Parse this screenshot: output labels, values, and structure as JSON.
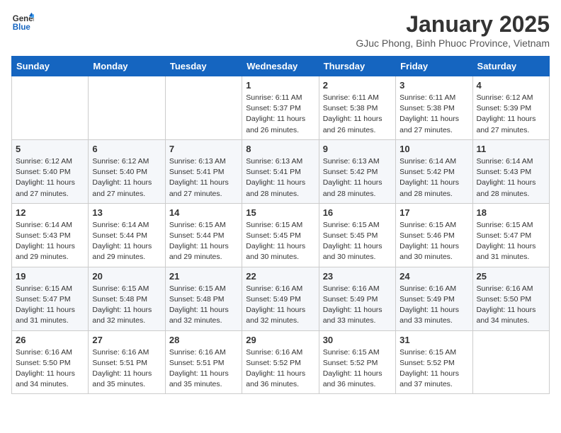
{
  "header": {
    "logo_line1": "General",
    "logo_line2": "Blue",
    "month_title": "January 2025",
    "subtitle": "GJuc Phong, Binh Phuoc Province, Vietnam"
  },
  "days_of_week": [
    "Sunday",
    "Monday",
    "Tuesday",
    "Wednesday",
    "Thursday",
    "Friday",
    "Saturday"
  ],
  "weeks": [
    [
      {
        "day": "",
        "info": ""
      },
      {
        "day": "",
        "info": ""
      },
      {
        "day": "",
        "info": ""
      },
      {
        "day": "1",
        "info": "Sunrise: 6:11 AM\nSunset: 5:37 PM\nDaylight: 11 hours and 26 minutes."
      },
      {
        "day": "2",
        "info": "Sunrise: 6:11 AM\nSunset: 5:38 PM\nDaylight: 11 hours and 26 minutes."
      },
      {
        "day": "3",
        "info": "Sunrise: 6:11 AM\nSunset: 5:38 PM\nDaylight: 11 hours and 27 minutes."
      },
      {
        "day": "4",
        "info": "Sunrise: 6:12 AM\nSunset: 5:39 PM\nDaylight: 11 hours and 27 minutes."
      }
    ],
    [
      {
        "day": "5",
        "info": "Sunrise: 6:12 AM\nSunset: 5:40 PM\nDaylight: 11 hours and 27 minutes."
      },
      {
        "day": "6",
        "info": "Sunrise: 6:12 AM\nSunset: 5:40 PM\nDaylight: 11 hours and 27 minutes."
      },
      {
        "day": "7",
        "info": "Sunrise: 6:13 AM\nSunset: 5:41 PM\nDaylight: 11 hours and 27 minutes."
      },
      {
        "day": "8",
        "info": "Sunrise: 6:13 AM\nSunset: 5:41 PM\nDaylight: 11 hours and 28 minutes."
      },
      {
        "day": "9",
        "info": "Sunrise: 6:13 AM\nSunset: 5:42 PM\nDaylight: 11 hours and 28 minutes."
      },
      {
        "day": "10",
        "info": "Sunrise: 6:14 AM\nSunset: 5:42 PM\nDaylight: 11 hours and 28 minutes."
      },
      {
        "day": "11",
        "info": "Sunrise: 6:14 AM\nSunset: 5:43 PM\nDaylight: 11 hours and 28 minutes."
      }
    ],
    [
      {
        "day": "12",
        "info": "Sunrise: 6:14 AM\nSunset: 5:43 PM\nDaylight: 11 hours and 29 minutes."
      },
      {
        "day": "13",
        "info": "Sunrise: 6:14 AM\nSunset: 5:44 PM\nDaylight: 11 hours and 29 minutes."
      },
      {
        "day": "14",
        "info": "Sunrise: 6:15 AM\nSunset: 5:44 PM\nDaylight: 11 hours and 29 minutes."
      },
      {
        "day": "15",
        "info": "Sunrise: 6:15 AM\nSunset: 5:45 PM\nDaylight: 11 hours and 30 minutes."
      },
      {
        "day": "16",
        "info": "Sunrise: 6:15 AM\nSunset: 5:45 PM\nDaylight: 11 hours and 30 minutes."
      },
      {
        "day": "17",
        "info": "Sunrise: 6:15 AM\nSunset: 5:46 PM\nDaylight: 11 hours and 30 minutes."
      },
      {
        "day": "18",
        "info": "Sunrise: 6:15 AM\nSunset: 5:47 PM\nDaylight: 11 hours and 31 minutes."
      }
    ],
    [
      {
        "day": "19",
        "info": "Sunrise: 6:15 AM\nSunset: 5:47 PM\nDaylight: 11 hours and 31 minutes."
      },
      {
        "day": "20",
        "info": "Sunrise: 6:15 AM\nSunset: 5:48 PM\nDaylight: 11 hours and 32 minutes."
      },
      {
        "day": "21",
        "info": "Sunrise: 6:15 AM\nSunset: 5:48 PM\nDaylight: 11 hours and 32 minutes."
      },
      {
        "day": "22",
        "info": "Sunrise: 6:16 AM\nSunset: 5:49 PM\nDaylight: 11 hours and 32 minutes."
      },
      {
        "day": "23",
        "info": "Sunrise: 6:16 AM\nSunset: 5:49 PM\nDaylight: 11 hours and 33 minutes."
      },
      {
        "day": "24",
        "info": "Sunrise: 6:16 AM\nSunset: 5:49 PM\nDaylight: 11 hours and 33 minutes."
      },
      {
        "day": "25",
        "info": "Sunrise: 6:16 AM\nSunset: 5:50 PM\nDaylight: 11 hours and 34 minutes."
      }
    ],
    [
      {
        "day": "26",
        "info": "Sunrise: 6:16 AM\nSunset: 5:50 PM\nDaylight: 11 hours and 34 minutes."
      },
      {
        "day": "27",
        "info": "Sunrise: 6:16 AM\nSunset: 5:51 PM\nDaylight: 11 hours and 35 minutes."
      },
      {
        "day": "28",
        "info": "Sunrise: 6:16 AM\nSunset: 5:51 PM\nDaylight: 11 hours and 35 minutes."
      },
      {
        "day": "29",
        "info": "Sunrise: 6:16 AM\nSunset: 5:52 PM\nDaylight: 11 hours and 36 minutes."
      },
      {
        "day": "30",
        "info": "Sunrise: 6:15 AM\nSunset: 5:52 PM\nDaylight: 11 hours and 36 minutes."
      },
      {
        "day": "31",
        "info": "Sunrise: 6:15 AM\nSunset: 5:52 PM\nDaylight: 11 hours and 37 minutes."
      },
      {
        "day": "",
        "info": ""
      }
    ]
  ]
}
